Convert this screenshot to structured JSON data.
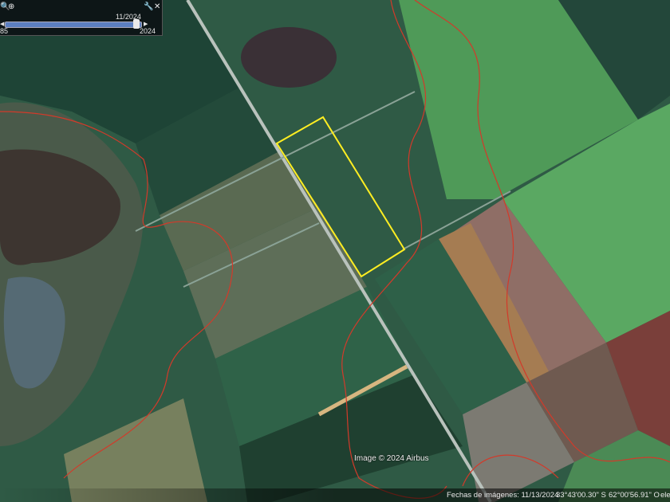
{
  "timeslider": {
    "current_date": "11/2024",
    "start_year": "1985",
    "start_label": "85",
    "end_year": "2024",
    "position_fraction": 0.97,
    "icons": [
      "zoom-out-icon",
      "zoom-in-icon",
      "wrench-icon",
      "close-icon",
      "play-back-icon",
      "play-forward-icon"
    ]
  },
  "map": {
    "copyright": "Image © 2024 Airbus",
    "boundary_color": "#ffee22",
    "parcel_line_color": "#d23a2a"
  },
  "status": {
    "imagery_date": "Fechas de imágenes: 11/13/2024",
    "latitude": "33°43'00.30\" S",
    "longitude": "62°00'56.91\" O",
    "elevation": "elev"
  }
}
